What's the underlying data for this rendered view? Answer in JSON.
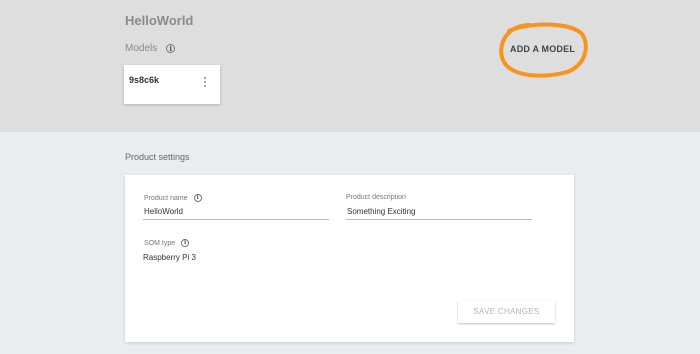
{
  "header": {
    "app_title": "HelloWorld",
    "models_label": "Models",
    "add_model_label": "ADD A MODEL",
    "highlight_color": "#f7931e"
  },
  "models": [
    {
      "name": "9s8c6k"
    }
  ],
  "product_settings": {
    "section_title": "Product settings",
    "product_name": {
      "label": "Product name",
      "value": "HelloWorld"
    },
    "product_description": {
      "label": "Product description",
      "value": "Something Exciting"
    },
    "som_type": {
      "label": "SOM type",
      "value": "Raspberry Pi 3"
    },
    "save_label": "SAVE CHANGES"
  },
  "icons": {
    "info": "info-icon",
    "menu": "more-vert-icon"
  }
}
